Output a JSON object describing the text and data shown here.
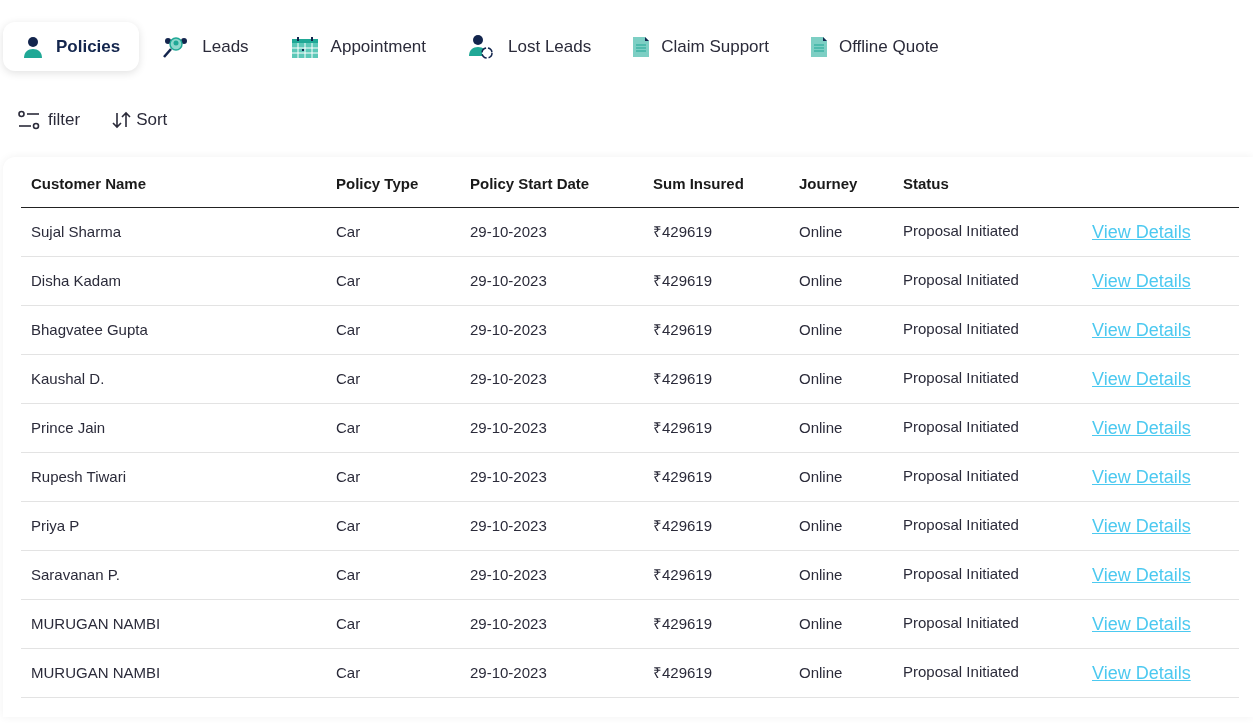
{
  "tabs": [
    {
      "label": "Policies",
      "kind": "person",
      "selected": true
    },
    {
      "label": "Leads",
      "kind": "leads",
      "selected": false
    },
    {
      "label": "Appointment",
      "kind": "calendar",
      "selected": false
    },
    {
      "label": "Lost Leads",
      "kind": "lost",
      "selected": false
    },
    {
      "label": "Claim Support",
      "kind": "document",
      "selected": false
    },
    {
      "label": "Offline Quote",
      "kind": "document",
      "selected": false
    }
  ],
  "toolbar": {
    "filter": "filter",
    "sort": "Sort"
  },
  "table": {
    "columns": [
      "Customer Name",
      "Policy Type",
      "Policy Start Date",
      "Sum Insured",
      "Journey",
      "Status"
    ],
    "rows": [
      {
        "cells": [
          "Sujal Sharma",
          "Car",
          "29-10-2023",
          "₹429619",
          "Online",
          "Proposal Initiated"
        ],
        "action": "View Details"
      },
      {
        "cells": [
          "Disha Kadam",
          "Car",
          "29-10-2023",
          "₹429619",
          "Online",
          "Proposal Initiated"
        ],
        "action": "View Details"
      },
      {
        "cells": [
          "Bhagvatee Gupta",
          "Car",
          "29-10-2023",
          "₹429619",
          "Online",
          "Proposal Initiated"
        ],
        "action": "View Details"
      },
      {
        "cells": [
          "Kaushal D.",
          "Car",
          "29-10-2023",
          "₹429619",
          "Online",
          "Proposal Initiated"
        ],
        "action": "View Details"
      },
      {
        "cells": [
          "Prince Jain",
          "Car",
          "29-10-2023",
          "₹429619",
          "Online",
          "Proposal Initiated"
        ],
        "action": "View Details"
      },
      {
        "cells": [
          "Rupesh Tiwari",
          "Car",
          "29-10-2023",
          "₹429619",
          "Online",
          "Proposal Initiated"
        ],
        "action": "View Details"
      },
      {
        "cells": [
          "Priya P",
          "Car",
          "29-10-2023",
          "₹429619",
          "Online",
          "Proposal Initiated"
        ],
        "action": "View Details"
      },
      {
        "cells": [
          "Saravanan P.",
          "Car",
          "29-10-2023",
          "₹429619",
          "Online",
          "Proposal Initiated"
        ],
        "action": "View Details"
      },
      {
        "cells": [
          "MURUGAN NAMBI",
          "Car",
          "29-10-2023",
          "₹429619",
          "Online",
          "Proposal Initiated"
        ],
        "action": "View Details"
      },
      {
        "cells": [
          "MURUGAN NAMBI",
          "Car",
          "29-10-2023",
          "₹429619",
          "Online",
          "Proposal Initiated"
        ],
        "action": "View Details"
      }
    ]
  }
}
